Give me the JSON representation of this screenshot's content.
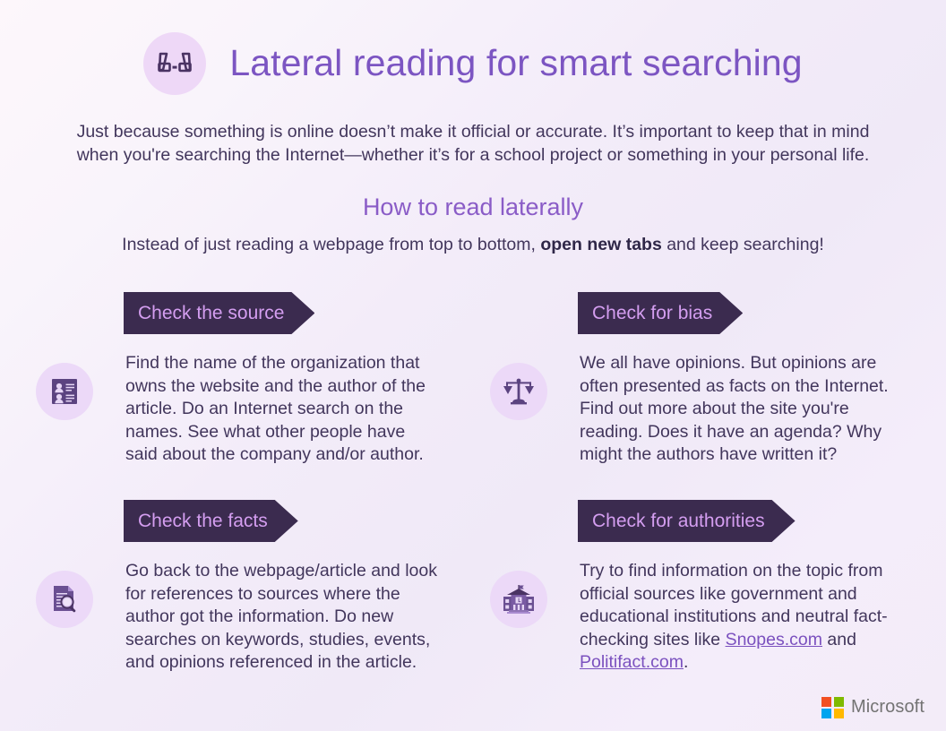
{
  "header": {
    "icon": "glasses-icon",
    "title": "Lateral reading for smart searching",
    "icon_circle_color": "#eed8f7",
    "title_color": "#7c55c2"
  },
  "intro": {
    "line1": "Just because something is online doesn’t make it official or accurate. It’s important to keep that in mind",
    "line2": "when you're searching the Internet—whether it’s for a school project or something in your personal life."
  },
  "section": {
    "heading": "How to read laterally",
    "sub_before": "Instead of just reading a webpage from top to bottom, ",
    "sub_bold": "open new tabs",
    "sub_after": " and keep searching!"
  },
  "cards": [
    {
      "id": "check-the-source",
      "banner": "Check the source",
      "icon": "contact-list-icon",
      "text": "Find the name of the organization that owns the website and the author of the article. Do an Internet search on the names. See what other people have said about the company and/or author."
    },
    {
      "id": "check-for-bias",
      "banner": "Check for bias",
      "icon": "balance-scales-icon",
      "text": "We all have opinions. But opinions are often presented as facts on the Internet. Find out more about the site you're reading. Does it have an agenda? Why might the authors have written it?"
    },
    {
      "id": "check-the-facts",
      "banner": "Check the facts",
      "icon": "document-search-icon",
      "text": "Go back to the webpage/article and look for references to sources where the author got the information. Do new searches on keywords, studies, events, and opinions referenced in the article."
    },
    {
      "id": "check-for-authorities",
      "banner": "Check for authorities",
      "icon": "government-building-icon",
      "text_before": "Try to find information on the topic from official sources like government and educational institutions and neutral fact-checking sites like ",
      "link1": "Snopes.com",
      "text_middle": " and ",
      "link2": "Politifact.com",
      "text_after": "."
    }
  ],
  "theme": {
    "banner_bg": "#3b2b4f",
    "banner_text": "#d49ef0",
    "icon_circle": "#ecd9f8",
    "body_text": "#42365c",
    "link_color": "#7b51bf"
  },
  "footer": {
    "brand": "Microsoft",
    "logo_colors": {
      "red": "#f25022",
      "green": "#7fba00",
      "blue": "#00a4ef",
      "yellow": "#ffb900"
    },
    "brand_color": "#737373"
  }
}
